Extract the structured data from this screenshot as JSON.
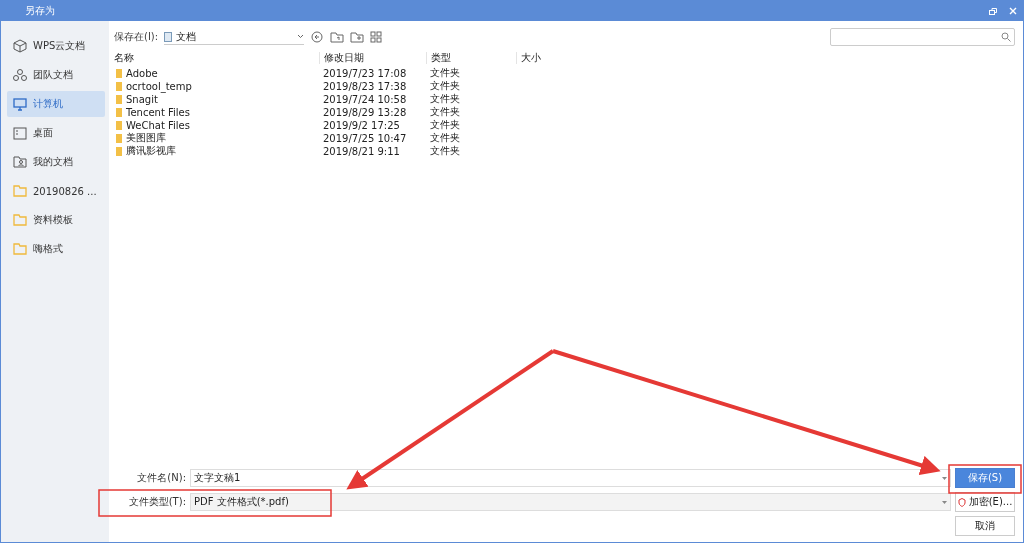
{
  "window": {
    "title": "另存为"
  },
  "sidebar": {
    "items": [
      {
        "label": "WPS云文档",
        "kind": "cloud",
        "selected": false
      },
      {
        "label": "团队文档",
        "kind": "team",
        "selected": false
      },
      {
        "label": "计算机",
        "kind": "computer",
        "selected": true
      },
      {
        "label": "桌面",
        "kind": "desktop",
        "selected": false
      },
      {
        "label": "我的文档",
        "kind": "docs",
        "selected": false
      },
      {
        "label": "20190826 ...",
        "kind": "folder",
        "selected": false
      },
      {
        "label": "资料模板",
        "kind": "folder",
        "selected": false
      },
      {
        "label": "嗨格式",
        "kind": "folder",
        "selected": false
      }
    ]
  },
  "location": {
    "label": "保存在(I):",
    "value": "文档"
  },
  "table": {
    "columns": [
      "名称",
      "修改日期",
      "类型",
      "大小"
    ],
    "rows": [
      {
        "name": "Adobe",
        "date": "2019/7/23 17:08",
        "type": "文件夹"
      },
      {
        "name": "ocrtool_temp",
        "date": "2019/8/23 17:38",
        "type": "文件夹"
      },
      {
        "name": "Snagit",
        "date": "2019/7/24 10:58",
        "type": "文件夹"
      },
      {
        "name": "Tencent Files",
        "date": "2019/8/29 13:28",
        "type": "文件夹"
      },
      {
        "name": "WeChat Files",
        "date": "2019/9/2 17:25",
        "type": "文件夹"
      },
      {
        "name": "美图图库",
        "date": "2019/7/25 10:47",
        "type": "文件夹"
      },
      {
        "name": "腾讯影视库",
        "date": "2019/8/21 9:11",
        "type": "文件夹"
      }
    ]
  },
  "filename": {
    "label": "文件名(N):",
    "value": "文字文稿1"
  },
  "filetype": {
    "label": "文件类型(T):",
    "value": "PDF 文件格式(*.pdf)"
  },
  "buttons": {
    "save": "保存(S)",
    "encrypt": "加密(E)...",
    "cancel": "取消"
  }
}
